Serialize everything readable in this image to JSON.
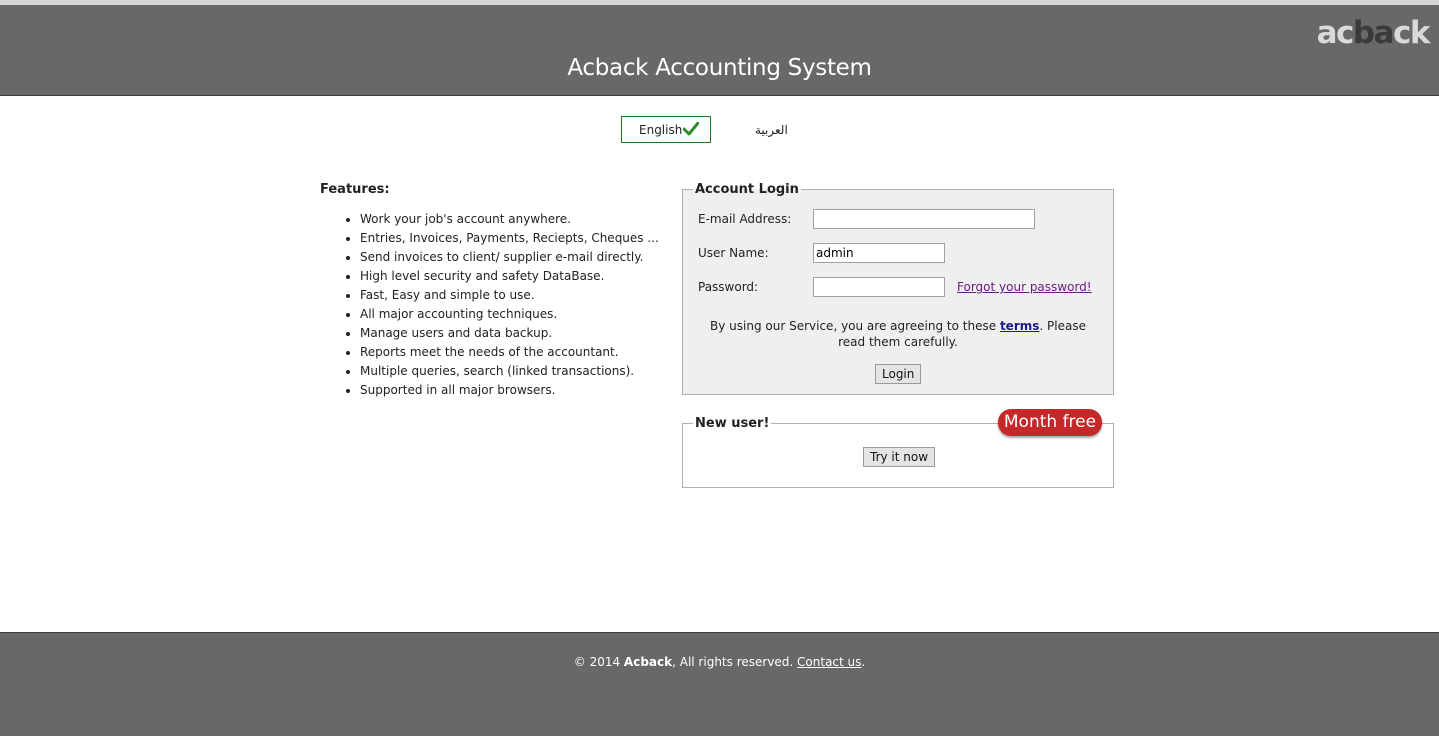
{
  "header": {
    "title": "Acback Accounting System",
    "logo": {
      "part1": "ac",
      "part2": "ba",
      "part3": "ck"
    }
  },
  "language": {
    "english_label": "English",
    "arabic_label": "العربية"
  },
  "features": {
    "title": "Features:",
    "items": [
      "Work your job's account anywhere.",
      "Entries, Invoices, Payments, Reciepts, Cheques ...",
      "Send invoices to client/ supplier e-mail directly.",
      "High level security and safety DataBase.",
      "Fast, Easy and simple to use.",
      "All major accounting techniques.",
      "Manage users and data backup.",
      "Reports meet the needs of the accountant.",
      "Multiple queries, search (linked transactions).",
      "Supported in all major browsers."
    ]
  },
  "login": {
    "legend": "Account Login",
    "email_label": "E-mail Address:",
    "email_value": "",
    "username_label": "User Name:",
    "username_value": "admin",
    "password_label": "Password:",
    "password_value": "",
    "forgot_link": "Forgot your password!",
    "terms_before": "By using our Service, you are agreeing to these ",
    "terms_link": "terms",
    "terms_after": ". Please read them carefully.",
    "login_button": "Login"
  },
  "new_user": {
    "legend": "New user!",
    "badge": "Month free",
    "try_button": "Try it now"
  },
  "footer": {
    "copyright": "© 2014 ",
    "brand": "Acback",
    "rights": ", All rights reserved. ",
    "contact_link": "Contact us",
    "end": "."
  }
}
